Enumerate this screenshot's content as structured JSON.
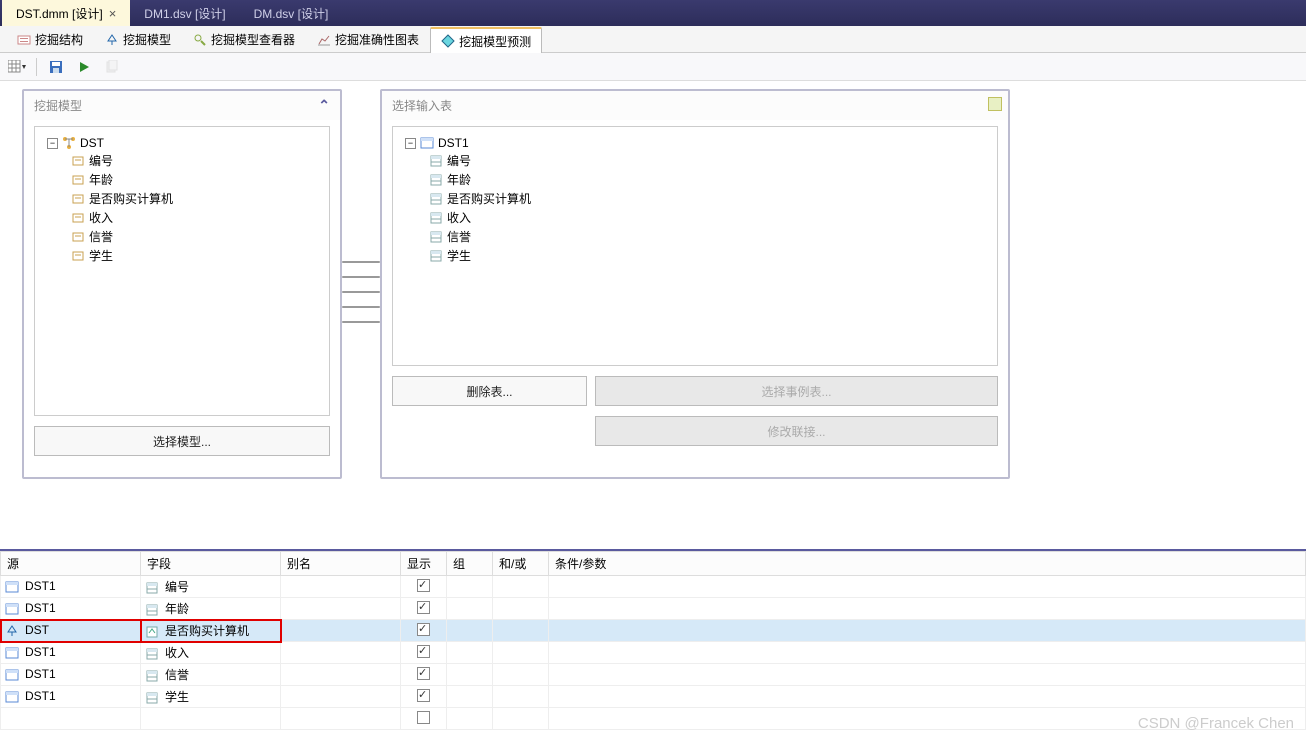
{
  "docTabs": [
    {
      "label": "DST.dmm [设计]",
      "active": true,
      "closeable": true
    },
    {
      "label": "DM1.dsv [设计]",
      "active": false,
      "closeable": false
    },
    {
      "label": "DM.dsv [设计]",
      "active": false,
      "closeable": false
    }
  ],
  "toolTabs": [
    {
      "label": "挖掘结构",
      "icon": "structure-icon"
    },
    {
      "label": "挖掘模型",
      "icon": "model-icon"
    },
    {
      "label": "挖掘模型查看器",
      "icon": "viewer-icon"
    },
    {
      "label": "挖掘准确性图表",
      "icon": "chart-icon"
    },
    {
      "label": "挖掘模型预测",
      "icon": "predict-icon",
      "active": true
    }
  ],
  "leftPanel": {
    "title": "挖掘模型",
    "rootLabel": "DST",
    "items": [
      "编号",
      "年龄",
      "是否购买计算机",
      "收入",
      "信誉",
      "学生"
    ],
    "button": "选择模型..."
  },
  "rightPanel": {
    "title": "选择输入表",
    "rootLabel": "DST1",
    "items": [
      "编号",
      "年龄",
      "是否购买计算机",
      "收入",
      "信誉",
      "学生"
    ],
    "buttons": {
      "delete": "删除表...",
      "cases": "选择事例表...",
      "join": "修改联接..."
    }
  },
  "grid": {
    "headers": {
      "src": "源",
      "fld": "字段",
      "alias": "别名",
      "show": "显示",
      "grp": "组",
      "andor": "和/或",
      "cond": "条件/参数"
    },
    "rows": [
      {
        "src": "DST1",
        "srcIcon": "table-icon",
        "fld": "编号",
        "fldIcon": "column-icon",
        "show": true
      },
      {
        "src": "DST1",
        "srcIcon": "table-icon",
        "fld": "年龄",
        "fldIcon": "column-icon",
        "show": true
      },
      {
        "src": "DST",
        "srcIcon": "model-icon",
        "fld": "是否购买计算机",
        "fldIcon": "predict-col-icon",
        "show": true,
        "highlight": true,
        "selected": true
      },
      {
        "src": "DST1",
        "srcIcon": "table-icon",
        "fld": "收入",
        "fldIcon": "column-icon",
        "show": true
      },
      {
        "src": "DST1",
        "srcIcon": "table-icon",
        "fld": "信誉",
        "fldIcon": "column-icon",
        "show": true
      },
      {
        "src": "DST1",
        "srcIcon": "table-icon",
        "fld": "学生",
        "fldIcon": "column-icon",
        "show": true
      }
    ]
  },
  "watermark": "CSDN @Francek Chen"
}
